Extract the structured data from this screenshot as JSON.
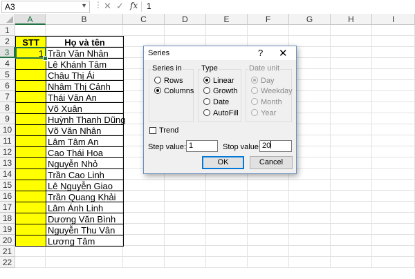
{
  "formula_bar": {
    "name_box": "A3",
    "fx": "fx",
    "value": "1"
  },
  "columns": [
    "A",
    "B",
    "C",
    "D",
    "E",
    "F",
    "G",
    "H",
    "I"
  ],
  "rows": [
    "1",
    "2",
    "3",
    "4",
    "5",
    "6",
    "7",
    "8",
    "9",
    "10",
    "11",
    "12",
    "13",
    "14",
    "15",
    "16",
    "17",
    "18",
    "19",
    "20",
    "21",
    "22"
  ],
  "table": {
    "header_stt": "STT",
    "header_name": "Họ và tên",
    "a3_value": "1",
    "names": [
      "Trần Văn Nhân",
      "Lê Khánh Tâm",
      "Châu Thị Ái",
      "Nhâm Thị Cảnh",
      "Thái Văn An",
      "Võ Xuân",
      "Huỳnh Thanh Dũng",
      "Võ Văn Nhân",
      "Lâm Tâm An",
      "Cao Thái Hoa",
      "Nguyễn Nhỏ",
      "Trần Cao Linh",
      "Lê Nguyễn Giao",
      "Trần Quang Khải",
      "Lâm Ánh Linh",
      "Dương Văn Bình",
      "Nguyễn Thu Vân",
      "Lương Tâm"
    ]
  },
  "dialog": {
    "title": "Series",
    "help": "?",
    "close": "✕",
    "series_in": {
      "label": "Series in",
      "rows": "Rows",
      "columns": "Columns",
      "selected": "Columns"
    },
    "type": {
      "label": "Type",
      "linear": "Linear",
      "growth": "Growth",
      "date": "Date",
      "autofill": "AutoFill",
      "selected": "Linear"
    },
    "date_unit": {
      "label": "Date unit",
      "day": "Day",
      "weekday": "Weekday",
      "month": "Month",
      "year": "Year",
      "selected": "Day",
      "enabled": false
    },
    "trend": {
      "label": "Trend",
      "checked": false
    },
    "step_value": {
      "label": "Step value:",
      "value": "1"
    },
    "stop_value": {
      "label": "Stop value:",
      "value": "20"
    },
    "ok": "OK",
    "cancel": "Cancel"
  }
}
